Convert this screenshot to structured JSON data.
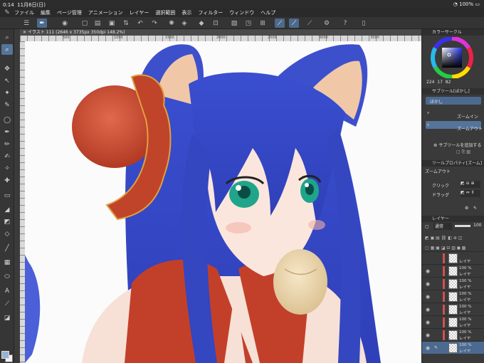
{
  "status_bar": {
    "time": "0:14",
    "date": "11月6日(日)",
    "battery": "100%"
  },
  "menu": [
    "ファイル",
    "編集",
    "ページ管理",
    "アニメーション",
    "レイヤー",
    "選択範囲",
    "表示",
    "フィルター",
    "ウィンドウ",
    "ヘルプ"
  ],
  "document": {
    "tab_title": "イラスト 111 (2646 x 3735px 350dpi 148.2%)"
  },
  "ruler": {
    "marks": [
      "500",
      "1000",
      "1500",
      "2000",
      "2500",
      "3000",
      "3500"
    ]
  },
  "color_wheel": {
    "title": "カラーサークル",
    "values": [
      "224",
      "17",
      "82"
    ]
  },
  "subtool": {
    "title": "サブツール[ぼかし]",
    "group": "ぼかし",
    "items": [
      "ズームイン",
      "ズームアウト"
    ],
    "add_label": "サブツールを追加する"
  },
  "tool_property": {
    "title": "ツールプロパティ[ズーム]",
    "tool_name": "ズームアウト",
    "click_label": "クリック",
    "drag_label": "ドラッグ"
  },
  "layers": {
    "title": "レイヤー",
    "blend_mode": "通常",
    "opacity": "100",
    "rows": [
      {
        "opacity": "",
        "name": "レイヤ"
      },
      {
        "opacity": "100 %",
        "name": "レイヤ"
      },
      {
        "opacity": "100 %",
        "name": "レイヤ"
      },
      {
        "opacity": "100 %",
        "name": "レイヤ"
      },
      {
        "opacity": "100 %",
        "name": "レイヤ"
      },
      {
        "opacity": "100 %",
        "name": "レイヤ"
      },
      {
        "opacity": "100 %",
        "name": "レイヤ"
      },
      {
        "opacity": "100 %",
        "name": "レイヤ"
      }
    ]
  },
  "colors": {
    "accent": "#55749a",
    "main_color": "#9ab2d6",
    "hair": "#3d4fc4",
    "ribbon": "#c0442a",
    "eyes": "#27b59a"
  }
}
